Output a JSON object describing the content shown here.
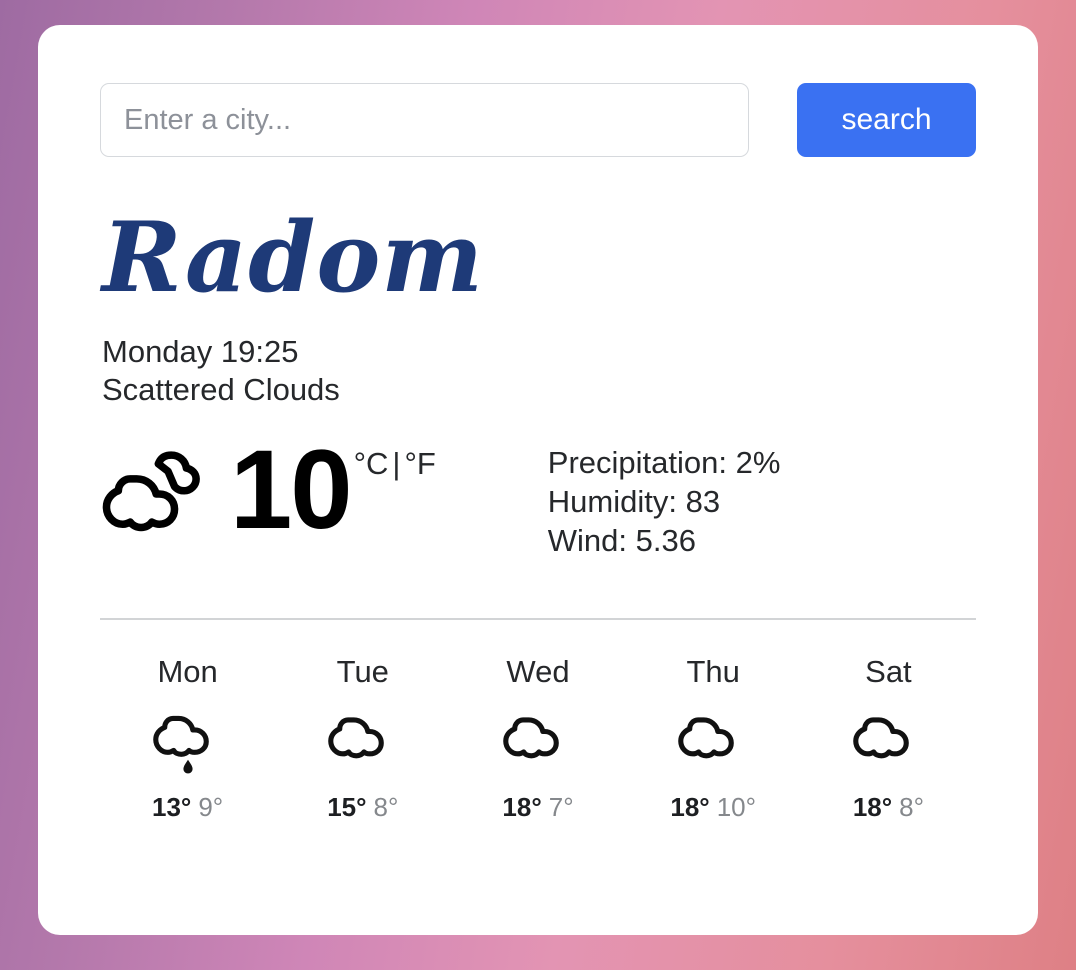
{
  "theme": {
    "accent_blue": "#3a71f2",
    "city_blue": "#1e3a78",
    "bg_gradient_from": "#9e6ba2",
    "bg_gradient_mid": "#e394b3",
    "bg_gradient_to": "#de8085",
    "card_bg": "#ffffff",
    "muted_text": "#85888c"
  },
  "search": {
    "placeholder": "Enter a city...",
    "value": "",
    "button_label": "search"
  },
  "current": {
    "city": "Radom",
    "datetime": "Monday 19:25",
    "condition": "Scattered Clouds",
    "icon": "scattered-clouds-icon",
    "temperature": "10",
    "unit_celsius": "°C",
    "unit_separator": "|",
    "unit_fahrenheit": "°F",
    "details": [
      "Precipitation: 2%",
      "Humidity: 83",
      "Wind: 5.36"
    ]
  },
  "forecast": [
    {
      "day": "Mon",
      "icon": "rain-cloud-icon",
      "high": "13°",
      "low": "9°"
    },
    {
      "day": "Tue",
      "icon": "cloud-icon",
      "high": "15°",
      "low": "8°"
    },
    {
      "day": "Wed",
      "icon": "cloud-icon",
      "high": "18°",
      "low": "7°"
    },
    {
      "day": "Thu",
      "icon": "cloud-icon",
      "high": "18°",
      "low": "10°"
    },
    {
      "day": "Sat",
      "icon": "cloud-icon",
      "high": "18°",
      "low": "8°"
    }
  ]
}
